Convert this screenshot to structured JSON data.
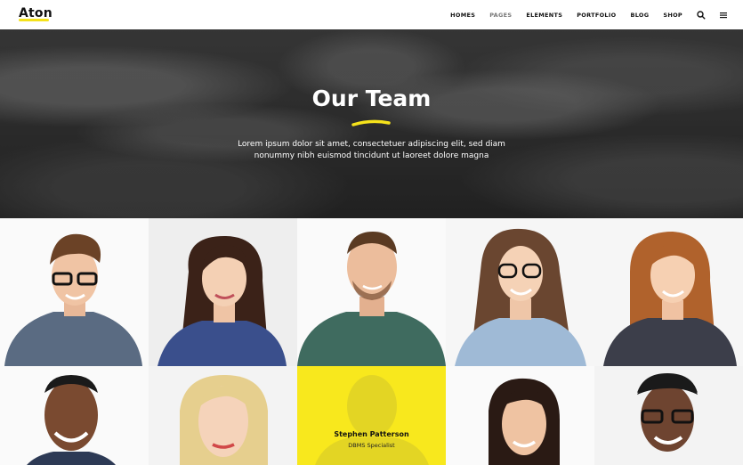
{
  "header": {
    "logo": "Aton",
    "nav": [
      "HOMES",
      "PAGES",
      "ELEMENTS",
      "PORTFOLIO",
      "BLOG",
      "SHOP"
    ],
    "icons": [
      "search-icon",
      "menu-icon"
    ]
  },
  "hero": {
    "title": "Our Team",
    "line1": "Lorem ipsum dolor sit amet, consectetuer adipiscing elit, sed diam",
    "line2": "nonummy nibh euismod tincidunt ut laoreet dolore magna"
  },
  "team": {
    "featured": {
      "name": "Stephen Patterson",
      "role": "DBMS Specialist"
    }
  },
  "colors": {
    "accent": "#f8e81d",
    "logo_underline": "#f5e21b",
    "text": "#111111"
  }
}
